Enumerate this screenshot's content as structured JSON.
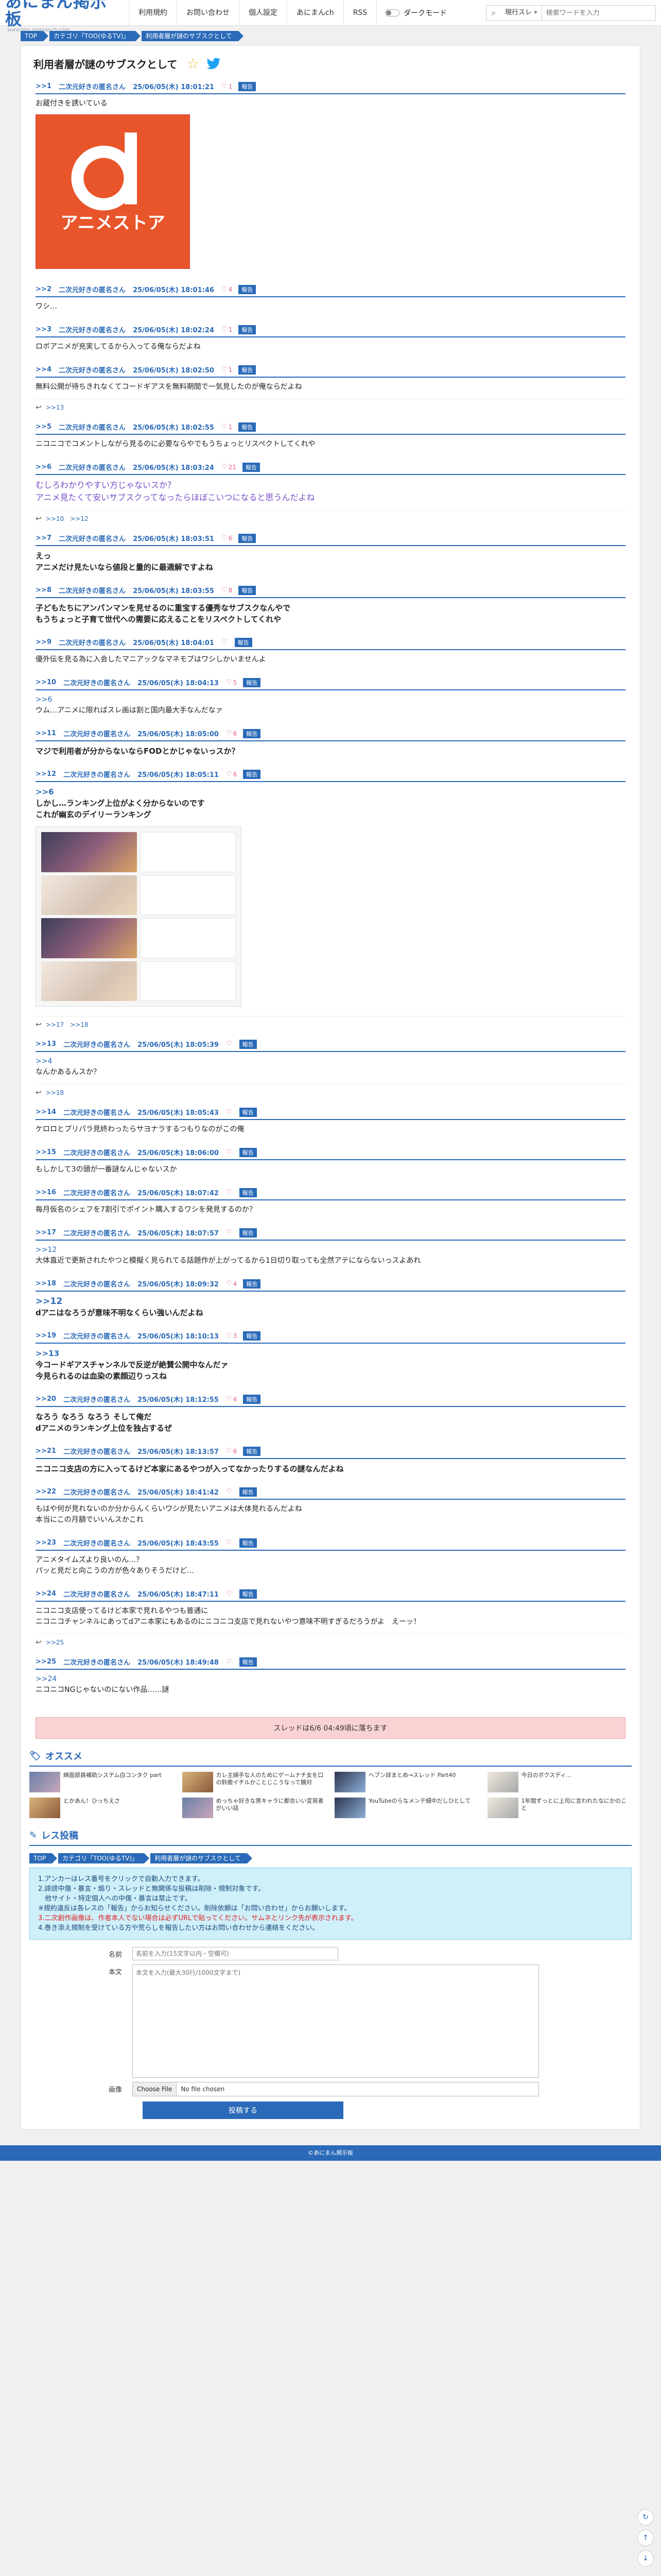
{
  "header": {
    "logo": "あにまん掲示板",
    "logo_url": "www.bbs.animanch.com",
    "nav": [
      "利用規約",
      "お問い合わせ",
      "個人設定",
      "あにまんch",
      "RSS"
    ],
    "dark_mode": "ダークモード",
    "search_scope": "現行スレ",
    "search_placeholder": "検索ワードを入力"
  },
  "breadcrumbs": [
    "TOP",
    "カテゴリ「TOO(ゆるTV)」",
    "利用者層が謎のサブスクとして"
  ],
  "thread": {
    "title": "利用者層が謎のサブスクとして",
    "thumb_text": "アニメストア"
  },
  "posts": [
    {
      "no": "1",
      "name": "二次元好きの匿名さん",
      "date": "25/06/05(木) 18:01:21",
      "likes": "1",
      "report": "報告",
      "body": [
        "お蔵付きを誘いている"
      ],
      "image": "danime"
    },
    {
      "no": "2",
      "name": "二次元好きの匿名さん",
      "date": "25/06/05(木) 18:01:46",
      "likes": "4",
      "report": "報告",
      "body": [
        "ワシ…"
      ]
    },
    {
      "no": "3",
      "name": "二次元好きの匿名さん",
      "date": "25/06/05(木) 18:02:24",
      "likes": "1",
      "report": "報告",
      "body": [
        "ロボアニメが充実してるから入ってる俺ならだよね"
      ]
    },
    {
      "no": "4",
      "name": "二次元好きの匿名さん",
      "date": "25/06/05(木) 18:02:50",
      "likes": "1",
      "report": "報告",
      "body": [
        "無料公開が待ちきれなくてコードギアスを無料期間で一気見したのが俺ならだよね"
      ],
      "replies": [
        ">>13"
      ]
    },
    {
      "no": "5",
      "name": "二次元好きの匿名さん",
      "date": "25/06/05(木) 18:02:55",
      "likes": "1",
      "report": "報告",
      "body": [
        "ニコニコでコメントしながら見るのに必要ならやでもうちょっとリスペクトしてくれや"
      ]
    },
    {
      "no": "6",
      "name": "二次元好きの匿名さん",
      "date": "25/06/05(木) 18:03:24",
      "likes": "21",
      "report": "報告",
      "body": [
        "むしろわかりやすい方じゃないスか？",
        "アニメ見たくて安いサブスクってなったらほぼこいつになると思うんだよね"
      ],
      "style": "big",
      "replies": [
        ">>10",
        ">>12"
      ]
    },
    {
      "no": "7",
      "name": "二次元好きの匿名さん",
      "date": "25/06/05(木) 18:03:51",
      "likes": "6",
      "report": "報告",
      "body": [
        "えっ",
        "アニメだけ見たいなら値段と量的に最適解ですよね"
      ],
      "style": "bold"
    },
    {
      "no": "8",
      "name": "二次元好きの匿名さん",
      "date": "25/06/05(木) 18:03:55",
      "likes": "8",
      "report": "報告",
      "body": [
        "子どもたちにアンパンマンを見せるのに重宝する優秀なサブスクなんやで",
        "もうちょっと子育て世代への需要に応えることをリスペクトしてくれや"
      ],
      "style": "bold"
    },
    {
      "no": "9",
      "name": "二次元好きの匿名さん",
      "date": "25/06/05(木) 18:04:01",
      "likes": "",
      "report": "報告",
      "body": [
        "優外伝を見る為に入会したマニアックなマネモブはワシしかいませんよ"
      ]
    },
    {
      "no": "10",
      "name": "二次元好きの匿名さん",
      "date": "25/06/05(木) 18:04:13",
      "likes": "5",
      "report": "報告",
      "anchor": ">>6",
      "body": [
        "ウム…アニメに限ればスレ画は割と国内最大手なんだなァ"
      ]
    },
    {
      "no": "11",
      "name": "二次元好きの匿名さん",
      "date": "25/06/05(木) 18:05:00",
      "likes": "6",
      "report": "報告",
      "body": [
        "マジで利用者が分からないならFODとかじゃないっスか？"
      ],
      "style": "bold"
    },
    {
      "no": "12",
      "name": "二次元好きの匿名さん",
      "date": "25/06/05(木) 18:05:11",
      "likes": "6",
      "report": "報告",
      "anchor": ">>6",
      "body": [
        "しかし…ランキング上位がよく分からないのです",
        "これが幽玄のデイリーランキング"
      ],
      "style": "bold",
      "image": "ranking",
      "replies": [
        ">>17",
        ">>18"
      ]
    },
    {
      "no": "13",
      "name": "二次元好きの匿名さん",
      "date": "25/06/05(木) 18:05:39",
      "likes": "",
      "report": "報告",
      "anchor": ">>4",
      "body": [
        "なんかあるんスか？"
      ],
      "replies": [
        ">>18"
      ]
    },
    {
      "no": "14",
      "name": "二次元好きの匿名さん",
      "date": "25/06/05(木) 18:05:43",
      "likes": "",
      "report": "報告",
      "body": [
        "ケロロとプリパラ見終わったらサヨナラするつもりなのがこの俺"
      ]
    },
    {
      "no": "15",
      "name": "二次元好きの匿名さん",
      "date": "25/06/05(木) 18:06:00",
      "likes": "",
      "report": "報告",
      "body": [
        "もしかして3の頭が一番謎なんじゃないスか"
      ]
    },
    {
      "no": "16",
      "name": "二次元好きの匿名さん",
      "date": "25/06/05(木) 18:07:42",
      "likes": "",
      "report": "報告",
      "body": [
        "毎月仮名のシェフを7割引でポイント購入するワシを発見するのか？"
      ]
    },
    {
      "no": "17",
      "name": "二次元好きの匿名さん",
      "date": "25/06/05(木) 18:07:57",
      "likes": "",
      "report": "報告",
      "anchor": ">>12",
      "body": [
        "大体直近で更新されたやつと模擬く見られてる話題作が上がってるから1日切り取っても全然アテにならないっスよあれ"
      ]
    },
    {
      "no": "18",
      "name": "二次元好きの匿名さん",
      "date": "25/06/05(木) 18:09:32",
      "likes": "4",
      "report": "報告",
      "anchor": ">>12",
      "anchor_big": true,
      "body": [
        "dアニはなろうが意味不明なくらい強いんだよね"
      ],
      "style": "bold"
    },
    {
      "no": "19",
      "name": "二次元好きの匿名さん",
      "date": "25/06/05(木) 18:10:13",
      "likes": "3",
      "report": "報告",
      "anchor": ">>13",
      "body": [
        "今コードギアスチャンネルで反逆が絶賛公開中なんだァ",
        "今見られるのは血染の素顔辺りっスね"
      ],
      "style": "bold"
    },
    {
      "no": "20",
      "name": "二次元好きの匿名さん",
      "date": "25/06/05(木) 18:12:55",
      "likes": "4",
      "report": "報告",
      "body": [
        "なろう なろう なろう そして俺だ",
        "dアニメのランキング上位を独占するぜ"
      ],
      "style": "bold"
    },
    {
      "no": "21",
      "name": "二次元好きの匿名さん",
      "date": "25/06/05(木) 18:13:57",
      "likes": "6",
      "report": "報告",
      "body": [
        "ニコニコ支店の方に入ってるけど本家にあるやつが入ってなかったりするの謎なんだよね"
      ],
      "style": "bold"
    },
    {
      "no": "22",
      "name": "二次元好きの匿名さん",
      "date": "25/06/05(木) 18:41:42",
      "likes": "",
      "report": "報告",
      "body": [
        "もはや何が見れないのか分からんくらいワシが見たいアニメは大体見れるんだよね",
        "本当にこの月額でいいんスかこれ"
      ]
    },
    {
      "no": "23",
      "name": "二次元好きの匿名さん",
      "date": "25/06/05(木) 18:43:55",
      "likes": "",
      "report": "報告",
      "body": [
        "アニメタイムズより良いのん…？",
        "パッと見だと向こうの方が色々ありそうだけど…"
      ]
    },
    {
      "no": "24",
      "name": "二次元好きの匿名さん",
      "date": "25/06/05(木) 18:47:11",
      "likes": "",
      "report": "報告",
      "body": [
        "ニコニコ支店使ってるけど本家で見れるやつも普通に",
        "ニコニコチャンネルにあってdアニ本家にもあるのにニコニコ支店で見れないやつ意味不明すぎるだろうがよ　えーッ！"
      ],
      "replies": [
        ">>25"
      ]
    },
    {
      "no": "25",
      "name": "二次元好きの匿名さん",
      "date": "25/06/05(木) 18:49:48",
      "likes": "",
      "report": "報告",
      "anchor": ">>24",
      "body": [
        "ニコニコNGじゃないのにない作品……謎"
      ]
    }
  ],
  "closed_notice": "スレッドは6/6 04:49頃に落ちます",
  "recommend": {
    "title": "オススメ",
    "items": [
      "綿面部員補助システム白コンタク part",
      "カレ主婦手な人のためにゲームナチ女を口の鈴鹿イチルかことじこうなって鏡対",
      "ヘブン詳まとめ→スレッド Part40",
      "今日のボクスディ...",
      "とかあん！ひっちえさ",
      "めっちゃ好きな男キャラに都合いい変質者がいい話",
      "YouTubeのらなメンテ細中だしひとして",
      "1年間ずっとに上司に言われたなにかのこと"
    ]
  },
  "form": {
    "title": "レス投稿",
    "rules": [
      "1.アンカーはレス番号をクリックで自動入力できます。",
      "2.誹謗中傷・暴言・煽り・スレッドと無関係な投稿は削除・規制対象です。",
      "　他サイト・特定個人への中傷・暴言は禁止です。",
      "※規約違反は各レスの「報告」からお知らせください。削除依頼は「お問い合わせ」からお願いします。",
      "3.二次創作画像は、作者本人でない場合は必ずURLで貼ってください。サムネとリンク先が表示されます。",
      "4.巻き添え規制を受けている方や荒らしを報告したい方はお問い合わせから連絡をください。"
    ],
    "name_label": "名前",
    "name_placeholder": "名前を入力(15文字以内・空欄可)",
    "body_label": "本文",
    "body_placeholder": "本文を入力(最大30行/1000文字まで)",
    "image_label": "画像",
    "file_button": "Choose File",
    "file_none": "No file chosen",
    "submit": "投稿する"
  },
  "footer": "©あにまん掲示板",
  "colors": {
    "accent": "#2a6ab8",
    "like": "#e06080",
    "closed_bg": "#f9d2d4",
    "rules_bg": "#cfeff9"
  }
}
